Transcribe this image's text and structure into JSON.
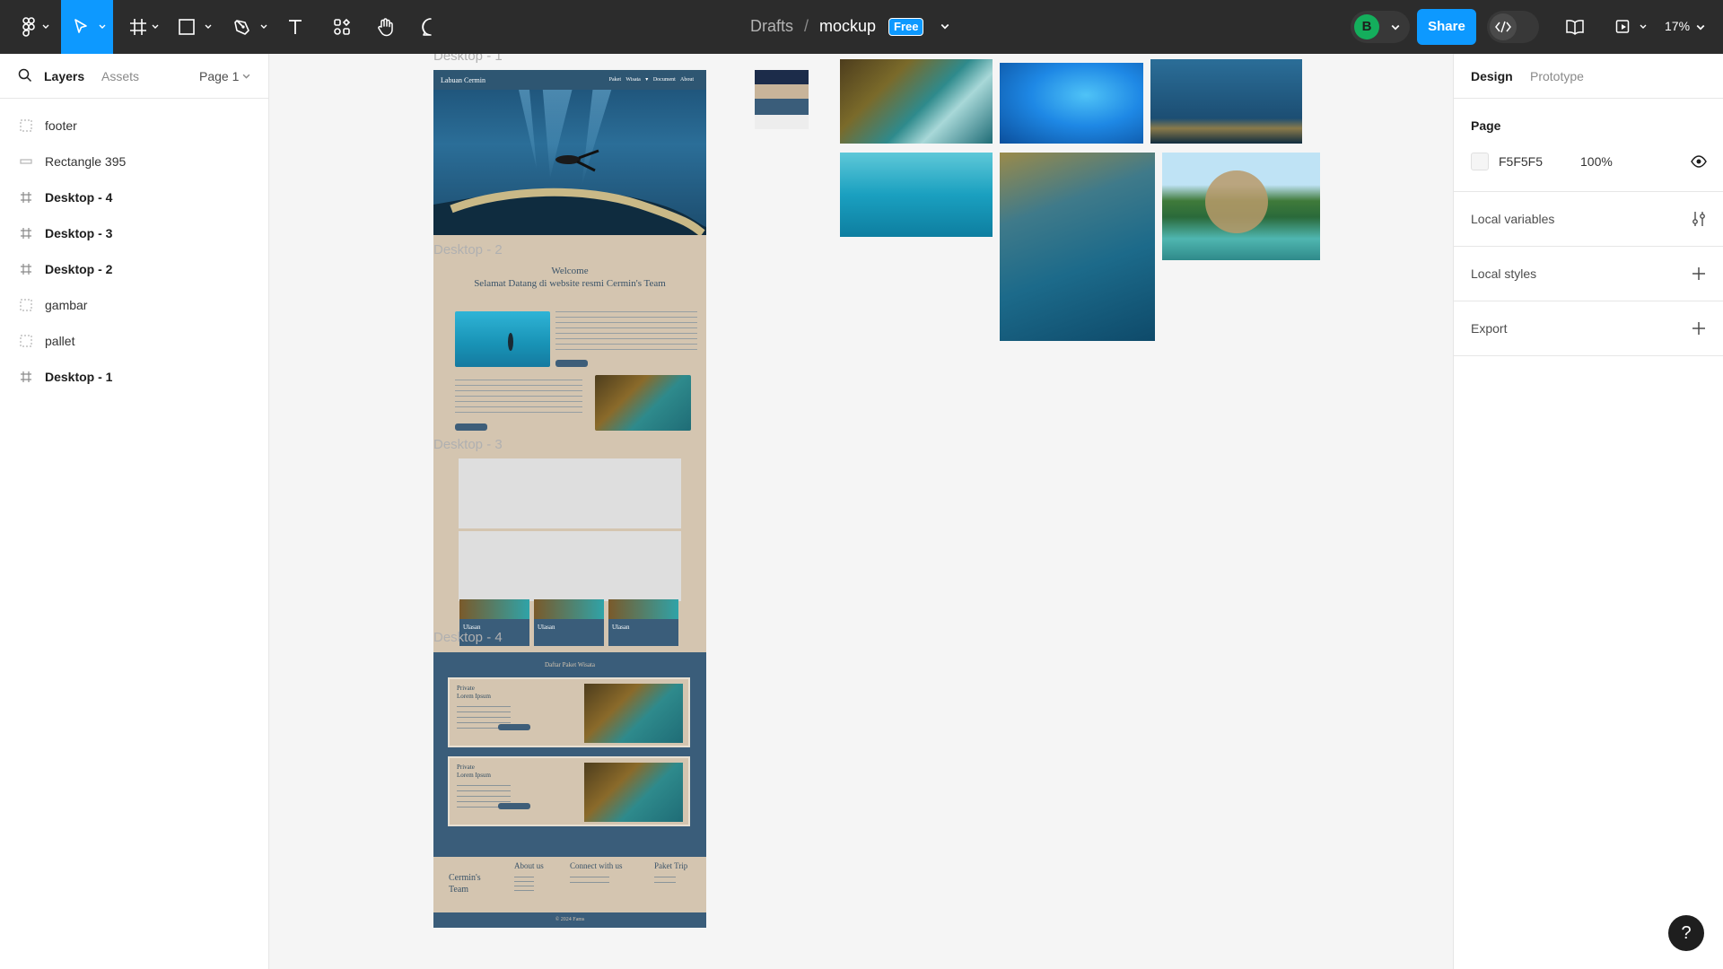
{
  "toolbar": {
    "file_breadcrumb": "Drafts",
    "separator": "/",
    "file_name": "mockup",
    "plan_badge": "Free",
    "avatar_initial": "B",
    "share_label": "Share",
    "zoom": "17%",
    "tools": [
      "main-menu-icon",
      "move-icon",
      "frame-icon",
      "rectangle-icon",
      "pen-icon",
      "text-icon",
      "resources-icon",
      "hand-icon",
      "comment-icon"
    ]
  },
  "left_panel": {
    "tabs": {
      "layers": "Layers",
      "assets": "Assets"
    },
    "page_selector": "Page 1",
    "layers": [
      {
        "name": "footer",
        "type": "section"
      },
      {
        "name": "Rectangle 395",
        "type": "rectangle"
      },
      {
        "name": "Desktop - 4",
        "type": "frame"
      },
      {
        "name": "Desktop - 3",
        "type": "frame"
      },
      {
        "name": "Desktop - 2",
        "type": "frame"
      },
      {
        "name": "gambar",
        "type": "section"
      },
      {
        "name": "pallet",
        "type": "section"
      },
      {
        "name": "Desktop - 1",
        "type": "frame"
      }
    ]
  },
  "right_panel": {
    "tabs": {
      "design": "Design",
      "prototype": "Prototype"
    },
    "page": {
      "title": "Page",
      "color_hex": "F5F5F5",
      "opacity": "100%"
    },
    "sections": {
      "local_variables": "Local variables",
      "local_styles": "Local styles",
      "export": "Export"
    }
  },
  "canvas": {
    "frame_labels": {
      "d1": "Desktop - 1",
      "d2": "Desktop - 2",
      "d3": "Desktop - 3",
      "d4": "Desktop - 4"
    },
    "mockup": {
      "brand": "Labuan Cermin",
      "nav_links": "Paket Wisata ▾  Document  About",
      "welcome": "Welcome",
      "welcome_sub": "Selamat Datang di website resmi Cermin's Team",
      "card_label": "Ulasan",
      "package_title": "Daftar Paket Wisata",
      "package_type": "Private",
      "package_name": "Lorem Ipsum",
      "footer_brand": "Cermin's Team",
      "footer_about": "About us",
      "footer_connect": "Connect with us",
      "footer_trip": "Paket Trip",
      "copyright": "© 2024 Fams"
    },
    "pallet_colors": [
      "#1c2c4a",
      "#c8b49a",
      "#3a5d7a"
    ]
  },
  "help_label": "?"
}
